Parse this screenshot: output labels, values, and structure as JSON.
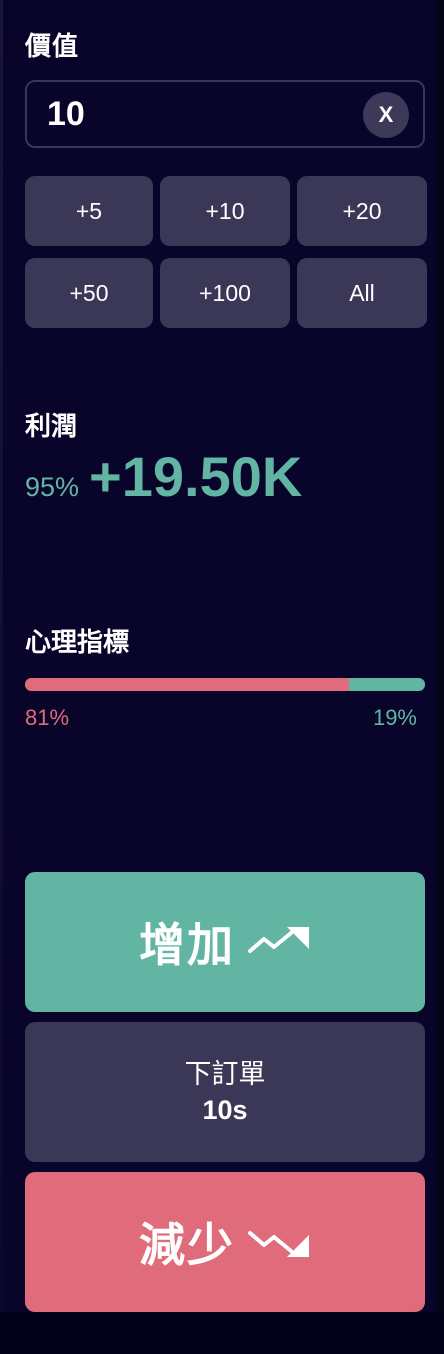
{
  "amount": {
    "label": "價值",
    "value": "10",
    "clear_label": "X"
  },
  "quick_amounts": [
    "+5",
    "+10",
    "+20",
    "+50",
    "+100",
    "All"
  ],
  "profit": {
    "label": "利潤",
    "percent": "95%",
    "value": "+19.50K",
    "color": "#62b5a3"
  },
  "sentiment": {
    "label": "心理指標",
    "down_percent": "81%",
    "up_percent": "19%",
    "down_fraction": 0.81,
    "up_fraction": 0.19,
    "down_color": "#e06b7a",
    "up_color": "#62b5a3"
  },
  "actions": {
    "up_label": "增加",
    "up_icon": "trend-up-icon",
    "up_color": "#62b5a3",
    "order_label": "下訂單",
    "order_timer": "10s",
    "down_label": "減少",
    "down_icon": "trend-down-icon",
    "down_color": "#e06b7a"
  }
}
